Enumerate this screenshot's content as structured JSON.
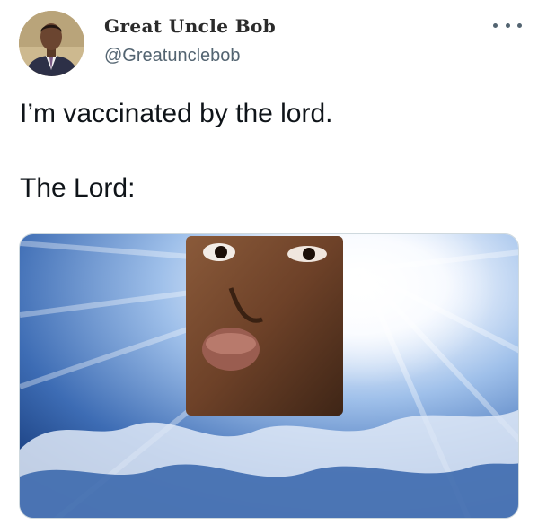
{
  "tweet": {
    "author": {
      "display_name": "Great Uncle Bob",
      "handle": "@Greatunclebob",
      "avatar_icon": "person-portrait-icon"
    },
    "more_icon": "more-dots-icon",
    "text_lines": [
      "I’m vaccinated by the lord.",
      "The Lord:"
    ],
    "media": {
      "description_icon": "heavenly-light-face-image"
    }
  },
  "colors": {
    "text_primary": "#0f1419",
    "text_secondary": "#536471",
    "sky_light": "#ffffff",
    "sky_dark": "#163a7a"
  }
}
